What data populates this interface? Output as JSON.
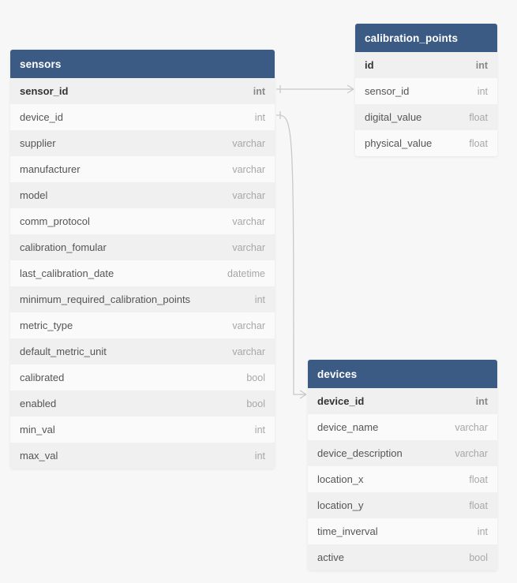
{
  "tables": {
    "sensors": {
      "title": "sensors",
      "columns": [
        {
          "name": "sensor_id",
          "type": "int",
          "pk": true
        },
        {
          "name": "device_id",
          "type": "int",
          "pk": false
        },
        {
          "name": "supplier",
          "type": "varchar",
          "pk": false
        },
        {
          "name": "manufacturer",
          "type": "varchar",
          "pk": false
        },
        {
          "name": "model",
          "type": "varchar",
          "pk": false
        },
        {
          "name": "comm_protocol",
          "type": "varchar",
          "pk": false
        },
        {
          "name": "calibration_fomular",
          "type": "varchar",
          "pk": false
        },
        {
          "name": "last_calibration_date",
          "type": "datetime",
          "pk": false
        },
        {
          "name": "minimum_required_calibration_points",
          "type": "int",
          "pk": false
        },
        {
          "name": "metric_type",
          "type": "varchar",
          "pk": false
        },
        {
          "name": "default_metric_unit",
          "type": "varchar",
          "pk": false
        },
        {
          "name": "calibrated",
          "type": "bool",
          "pk": false
        },
        {
          "name": "enabled",
          "type": "bool",
          "pk": false
        },
        {
          "name": "min_val",
          "type": "int",
          "pk": false
        },
        {
          "name": "max_val",
          "type": "int",
          "pk": false
        }
      ]
    },
    "calibration_points": {
      "title": "calibration_points",
      "columns": [
        {
          "name": "id",
          "type": "int",
          "pk": true
        },
        {
          "name": "sensor_id",
          "type": "int",
          "pk": false
        },
        {
          "name": "digital_value",
          "type": "float",
          "pk": false
        },
        {
          "name": "physical_value",
          "type": "float",
          "pk": false
        }
      ]
    },
    "devices": {
      "title": "devices",
      "columns": [
        {
          "name": "device_id",
          "type": "int",
          "pk": true
        },
        {
          "name": "device_name",
          "type": "varchar",
          "pk": false
        },
        {
          "name": "device_description",
          "type": "varchar",
          "pk": false
        },
        {
          "name": "location_x",
          "type": "float",
          "pk": false
        },
        {
          "name": "location_y",
          "type": "float",
          "pk": false
        },
        {
          "name": "time_inverval",
          "type": "int",
          "pk": false
        },
        {
          "name": "active",
          "type": "bool",
          "pk": false
        }
      ]
    }
  }
}
